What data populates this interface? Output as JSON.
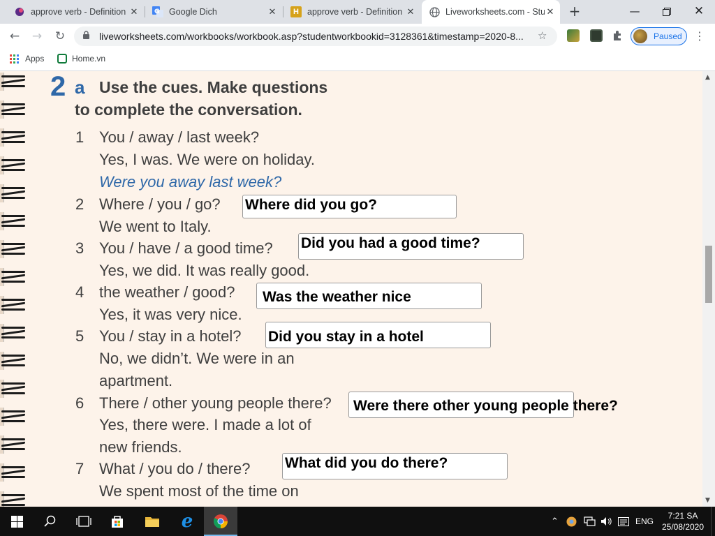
{
  "browser": {
    "tabs": [
      {
        "title": "approve verb - Definition",
        "favicon": "dictionary-icon",
        "active": false
      },
      {
        "title": "Google Dich",
        "favicon": "google-translate-icon",
        "active": false
      },
      {
        "title": "approve verb - Definition",
        "favicon": "h-icon",
        "active": false
      },
      {
        "title": "Liveworksheets.com - Stu",
        "favicon": "globe-icon",
        "active": true
      }
    ],
    "url": "liveworksheets.com/workbooks/workbook.asp?studentworkbookid=3128361&timestamp=2020-8...",
    "profile_label": "Paused",
    "bookmarks": [
      {
        "label": "Apps"
      },
      {
        "label": "Home.vn"
      }
    ]
  },
  "worksheet": {
    "exercise_number": "2",
    "exercise_letter": "a",
    "instruction_line1": "Use the cues. Make questions",
    "instruction_line2": "to complete the conversation.",
    "items": [
      {
        "num": "1",
        "lines": [
          "You / away / last week?",
          "Yes, I was. We were on holiday."
        ],
        "example": "Were you away last week?"
      },
      {
        "num": "2",
        "lines": [
          "Where / you / go?",
          "We went to Italy."
        ],
        "answer": "Where did you go?"
      },
      {
        "num": "3",
        "lines": [
          "You / have / a good time?",
          "Yes, we did. It was really good."
        ],
        "answer": "Did you had a good time?"
      },
      {
        "num": "4",
        "lines": [
          "the weather / good?",
          "Yes, it was very nice."
        ],
        "answer": " Was the weather nice"
      },
      {
        "num": "5",
        "lines": [
          "You / stay in a hotel?",
          "No, we didn’t. We were in an",
          "apartment."
        ],
        "answer": "Did you stay in a hotel"
      },
      {
        "num": "6",
        "lines": [
          "There / other young people there?",
          "Yes, there were. I made a lot of",
          "new friends."
        ],
        "answer": "Were there other young people there?"
      },
      {
        "num": "7",
        "lines": [
          "What / you do / there?",
          "We spent most of the time on"
        ],
        "answer": "What did you do there?"
      }
    ]
  },
  "taskbar": {
    "language": "ENG",
    "time": "7:21 SA",
    "date": "25/08/2020"
  }
}
